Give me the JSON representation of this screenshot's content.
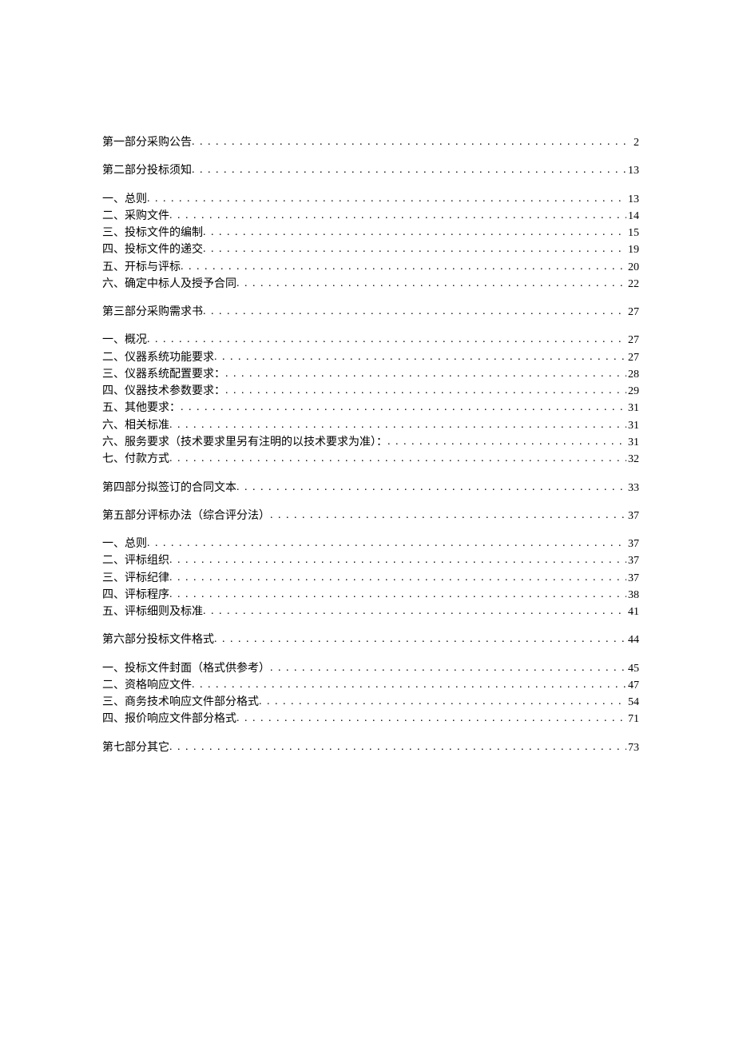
{
  "toc": [
    {
      "label": "第一部分采购公告",
      "page": "2",
      "gap": false
    },
    {
      "label": "第二部分投标须知",
      "page": "13",
      "gap": true
    },
    {
      "label": "一、总则",
      "page": "13",
      "gap": true
    },
    {
      "label": "二、采购文件",
      "page": "14",
      "gap": false
    },
    {
      "label": "三、投标文件的编制",
      "page": "15",
      "gap": false
    },
    {
      "label": "四、投标文件的递交",
      "page": "19",
      "gap": false
    },
    {
      "label": "五、开标与评标",
      "page": "20",
      "gap": false
    },
    {
      "label": "六、确定中标人及授予合同",
      "page": "22",
      "gap": false
    },
    {
      "label": "第三部分采购需求书",
      "page": "27",
      "gap": true
    },
    {
      "label": "一、概况",
      "page": "27",
      "gap": true
    },
    {
      "label": "二、仪器系统功能要求",
      "page": "27",
      "gap": false
    },
    {
      "label": "三、仪器系统配置要求：",
      "page": "28",
      "gap": false
    },
    {
      "label": "四、仪器技术参数要求：",
      "page": "29",
      "gap": false
    },
    {
      "label": "五、其他要求：",
      "page": "31",
      "gap": false
    },
    {
      "label": "六、相关标准",
      "page": "31",
      "gap": false
    },
    {
      "label": "六、服务要求（技术要求里另有注明的以技术要求为准）：",
      "page": "31",
      "gap": false
    },
    {
      "label": "七、付款方式",
      "page": "32",
      "gap": false
    },
    {
      "label": "第四部分拟签订的合同文本",
      "page": "33",
      "gap": true
    },
    {
      "label": "第五部分评标办法（综合评分法）",
      "page": "37",
      "gap": true
    },
    {
      "label": "一、总则",
      "page": "37",
      "gap": true
    },
    {
      "label": "二、评标组织",
      "page": "37",
      "gap": false
    },
    {
      "label": "三、评标纪律",
      "page": "37",
      "gap": false
    },
    {
      "label": "四、评标程序",
      "page": "38",
      "gap": false
    },
    {
      "label": "五、评标细则及标准",
      "page": "41",
      "gap": false
    },
    {
      "label": "第六部分投标文件格式",
      "page": "44",
      "gap": true
    },
    {
      "label": "一、投标文件封面（格式供参考）",
      "page": "45",
      "gap": true
    },
    {
      "label": "二、资格响应文件",
      "page": "47",
      "gap": false
    },
    {
      "label": "三、商务技术响应文件部分格式",
      "page": "54",
      "gap": false
    },
    {
      "label": "四、报价响应文件部分格式",
      "page": "71",
      "gap": false
    },
    {
      "label": "第七部分其它",
      "page": "73",
      "gap": true
    }
  ]
}
